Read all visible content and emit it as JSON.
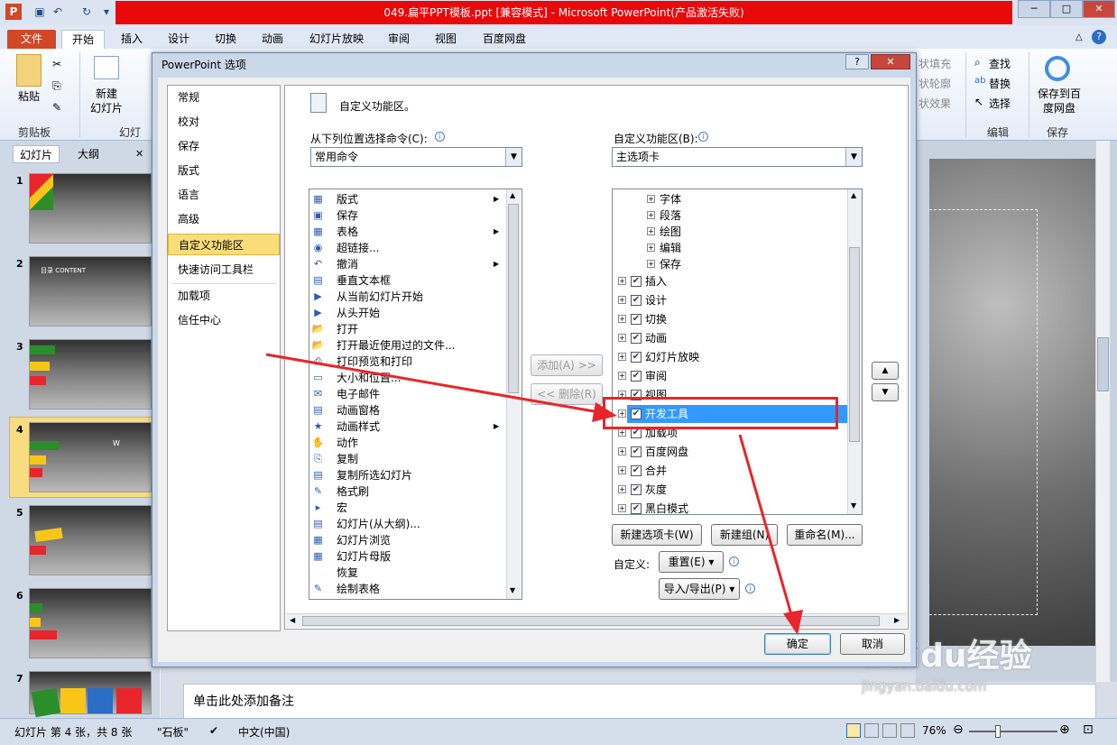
{
  "window": {
    "title": "049.扁平PPT模板.ppt [兼容模式] - Microsoft PowerPoint(产品激活失败)"
  },
  "ribbon": {
    "tabs": [
      "文件",
      "开始",
      "插入",
      "设计",
      "切换",
      "动画",
      "幻灯片放映",
      "审阅",
      "视图",
      "百度网盘"
    ],
    "paste": "粘贴",
    "new_slide": "新建\n幻灯片",
    "group_clipboard": "剪贴板",
    "group_slides": "幻灯",
    "find": "查找",
    "replace": "替换",
    "select": "选择",
    "group_edit": "编辑",
    "save_baidu": "保存到百\n度网盘",
    "group_save": "保存",
    "partial_fill": "状填充",
    "partial_outline": "状轮廓",
    "partial_effect": "状效果"
  },
  "leftpane": {
    "tab_slides": "幻灯片",
    "tab_outline": "大纲",
    "slides": [
      "1",
      "2",
      "3",
      "4",
      "5",
      "6",
      "7"
    ],
    "thumb2_text": "目录 CONTENT",
    "thumb4_text": "W"
  },
  "dialog": {
    "title": "PowerPoint 选项",
    "help": "?",
    "close": "✕",
    "nav": [
      "常规",
      "校对",
      "保存",
      "版式",
      "语言",
      "高级",
      "自定义功能区",
      "快速访问工具栏",
      "加载项",
      "信任中心"
    ],
    "header": "自定义功能区。",
    "left_label": "从下列位置选择命令(C):",
    "left_combo": "常用命令",
    "right_label": "自定义功能区(B):",
    "right_combo": "主选项卡",
    "commands": [
      "版式",
      "保存",
      "表格",
      "超链接...",
      "撤消",
      "垂直文本框",
      "从当前幻灯片开始",
      "从头开始",
      "打开",
      "打开最近使用过的文件...",
      "打印预览和打印",
      "大小和位置...",
      "电子邮件",
      "动画窗格",
      "动画样式",
      "动作",
      "复制",
      "复制所选幻灯片",
      "格式刷",
      "宏",
      "幻灯片(从大纲)...",
      "幻灯片浏览",
      "幻灯片母版",
      "恢复",
      "绘制表格"
    ],
    "tree_sub": [
      "字体",
      "段落",
      "绘图",
      "编辑",
      "保存"
    ],
    "tree_main": [
      "插入",
      "设计",
      "切换",
      "动画",
      "幻灯片放映",
      "审阅",
      "视图",
      "开发工具",
      "加载项",
      "百度网盘",
      "合并",
      "灰度",
      "黑白模式"
    ],
    "add": "添加(A) >>",
    "remove": "<< 删除(R)",
    "new_tab": "新建选项卡(W)",
    "new_group": "新建组(N)",
    "rename": "重命名(M)...",
    "customize_label": "自定义:",
    "reset": "重置(E)",
    "import_export": "导入/导出(P)",
    "ok": "确定",
    "cancel": "取消"
  },
  "notes": {
    "placeholder": "单击此处添加备注"
  },
  "status": {
    "slide_info": "幻灯片 第 4 张，共 8 张",
    "theme": "\"石板\"",
    "language": "中文(中国)",
    "zoom": "76%"
  },
  "watermark": {
    "brand": "Baidu经验",
    "url": "jingyan.baidu.com"
  }
}
